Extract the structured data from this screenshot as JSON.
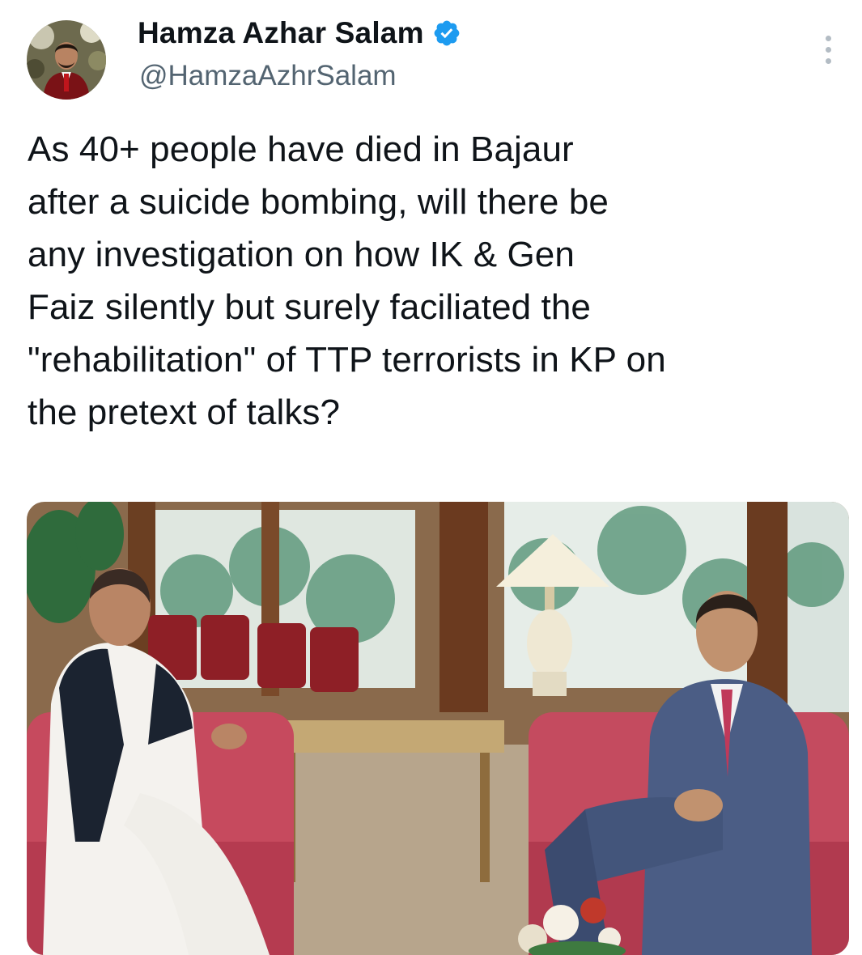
{
  "author": {
    "display_name": "Hamza Azhar Salam",
    "handle": "@HamzaAzhrSalam",
    "verified": true,
    "avatar_icon": "profile-photo",
    "verified_color": "#1d9bf0"
  },
  "menu": {
    "icon": "more-options-icon"
  },
  "tweet": {
    "lines": [
      "As 40+ people have died in Bajaur",
      "after a suicide bombing, will there be",
      "any investigation on how IK & Gen",
      "Faiz silently but surely faciliated the",
      "\"rehabilitation\" of TTP terrorists in KP on",
      "the pretext of talks?"
    ]
  },
  "media": {
    "type": "photo"
  },
  "colors": {
    "text": "#0f1419",
    "secondary": "#536471"
  }
}
